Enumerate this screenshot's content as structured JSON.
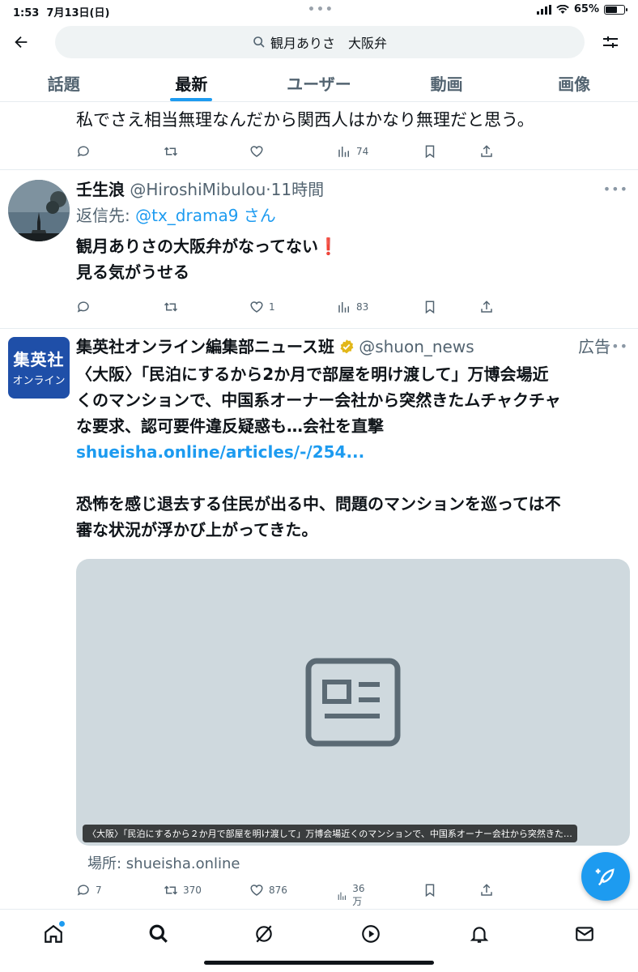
{
  "status_bar": {
    "time": "1:53",
    "date": "7月13日(日)",
    "battery": "65%",
    "battery_level": 0.65
  },
  "search": {
    "query": "観月ありさ　大阪弁"
  },
  "tabs": [
    {
      "label": "話題"
    },
    {
      "label": "最新"
    },
    {
      "label": "ユーザー"
    },
    {
      "label": "動画"
    },
    {
      "label": "画像"
    }
  ],
  "active_tab": "最新",
  "tweets": [
    {
      "text": "私でさえ相当無理なんだから関西人はかなり無理だと思う。",
      "views": "74"
    },
    {
      "name": "壬生浪",
      "handle": "@HiroshiMibulou",
      "time": "·11時間",
      "reply_prefix": "返信先:",
      "reply_to": "@tx_drama9 さん",
      "line1": "観月ありさの大阪弁がなってない",
      "emoji": "❗",
      "line2": "見る気がうせる",
      "likes": "1",
      "views": "83"
    },
    {
      "avatar_line1": "集英社",
      "avatar_line2": "オンライン",
      "name": "集英社オンライン編集部ニュース班",
      "handle": "@shuon_news",
      "ad_label": "広告",
      "lines": [
        "〈大阪〉「民泊にするから2か月で部屋を明け渡して」万博会場近",
        "くのマンションで、中国系オーナー会社から突然きたムチャクチャ",
        "な要求、認可要件違反疑惑も…会社を直撃"
      ],
      "url": "shueisha.online/articles/-/254...",
      "lines2": [
        "恐怖を感じ退去する住民が出る中、問題のマンションを巡っては不",
        "審な状況が浮かび上がってきた。"
      ],
      "card_caption": "〈大阪〉「民泊にするから２か月で部屋を明け渡して」万博会場近くのマンションで、中国系オーナー会社から突然きた…",
      "card_source": "場所: shueisha.online",
      "replies": "7",
      "retweets": "370",
      "likes": "876",
      "views": "36万"
    }
  ],
  "colors": {
    "accent": "#1d9bf0",
    "like_red": "#f91880",
    "text": "#0f1419",
    "muted": "#536471",
    "ad_bg": "#1f4fa8"
  }
}
